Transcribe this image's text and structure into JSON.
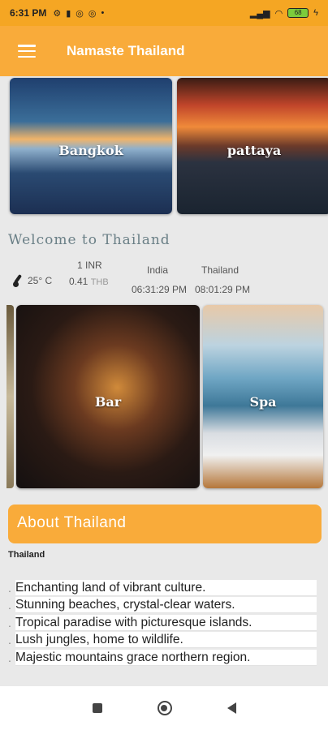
{
  "status_bar": {
    "time": "6:31 PM",
    "status_icons": [
      "settings-icon",
      "notification-icon",
      "whatsapp-icon",
      "whatsapp-icon"
    ],
    "battery": "68"
  },
  "app_bar": {
    "title": "Namaste Thailand"
  },
  "top_cards": [
    {
      "label": "Bangkok"
    },
    {
      "label": "pattaya"
    }
  ],
  "welcome": "Welcome to Thailand",
  "info": {
    "temperature": "25° C",
    "currency_from": "1 INR",
    "currency_value": "0.41",
    "currency_to": "THB",
    "country_a": "India",
    "country_b": "Thailand",
    "time_a": "06:31:29 PM",
    "time_b": "08:01:29 PM"
  },
  "activity_cards": [
    {
      "label": "Bar"
    },
    {
      "label": "Spa"
    }
  ],
  "about": {
    "heading": "About Thailand",
    "subtitle": "Thailand",
    "facts": [
      "Enchanting land of vibrant culture.",
      "Stunning beaches, crystal-clear waters.",
      "Tropical paradise with picturesque islands.",
      "Lush jungles, home to wildlife.",
      "Majestic mountains grace northern region."
    ]
  },
  "colors": {
    "accent": "#f9ab3a",
    "background": "#e9e9e9"
  }
}
